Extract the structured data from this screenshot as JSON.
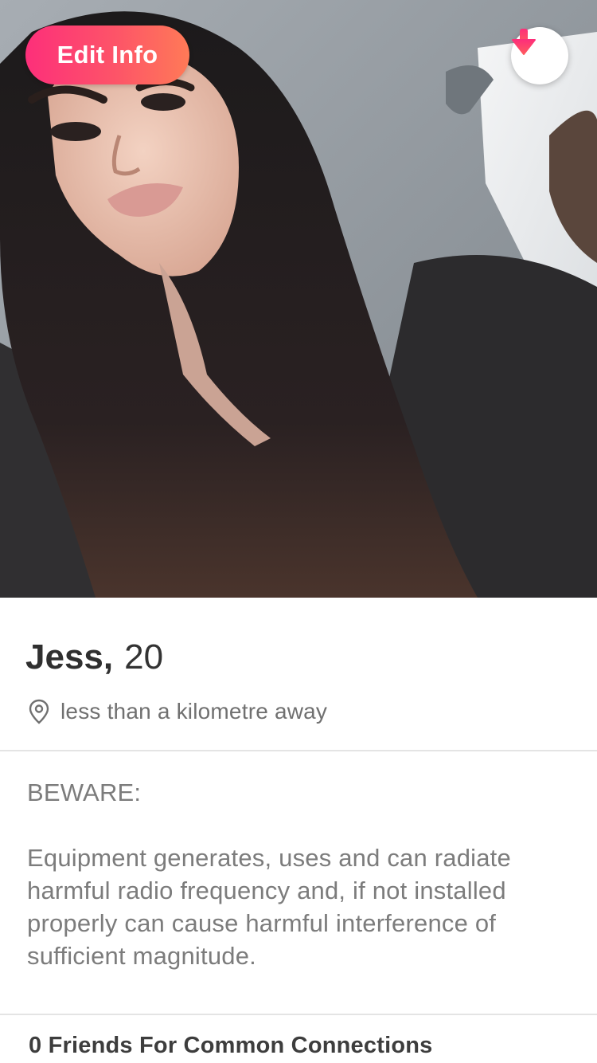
{
  "photo": {
    "description_icon": "profile-photo"
  },
  "header": {
    "edit_label": "Edit Info",
    "collapse_icon": "arrow-down-icon"
  },
  "profile": {
    "name": "Jess",
    "age": "20",
    "distance_icon": "location-pin-icon",
    "distance": "less than a kilometre away"
  },
  "bio": {
    "heading": "BEWARE:",
    "body": "Equipment generates, uses and can radiate harmful radio frequency and, if not installed properly can cause harmful interference of sufficient magnitude."
  },
  "connections": {
    "label": "0 Friends For Common Connections"
  },
  "colors": {
    "accent_start": "#fd2f7a",
    "accent_end": "#ff7a57",
    "text_primary": "#2f2f2f",
    "text_secondary": "#7c7c7c",
    "divider": "#e4e4e4"
  }
}
